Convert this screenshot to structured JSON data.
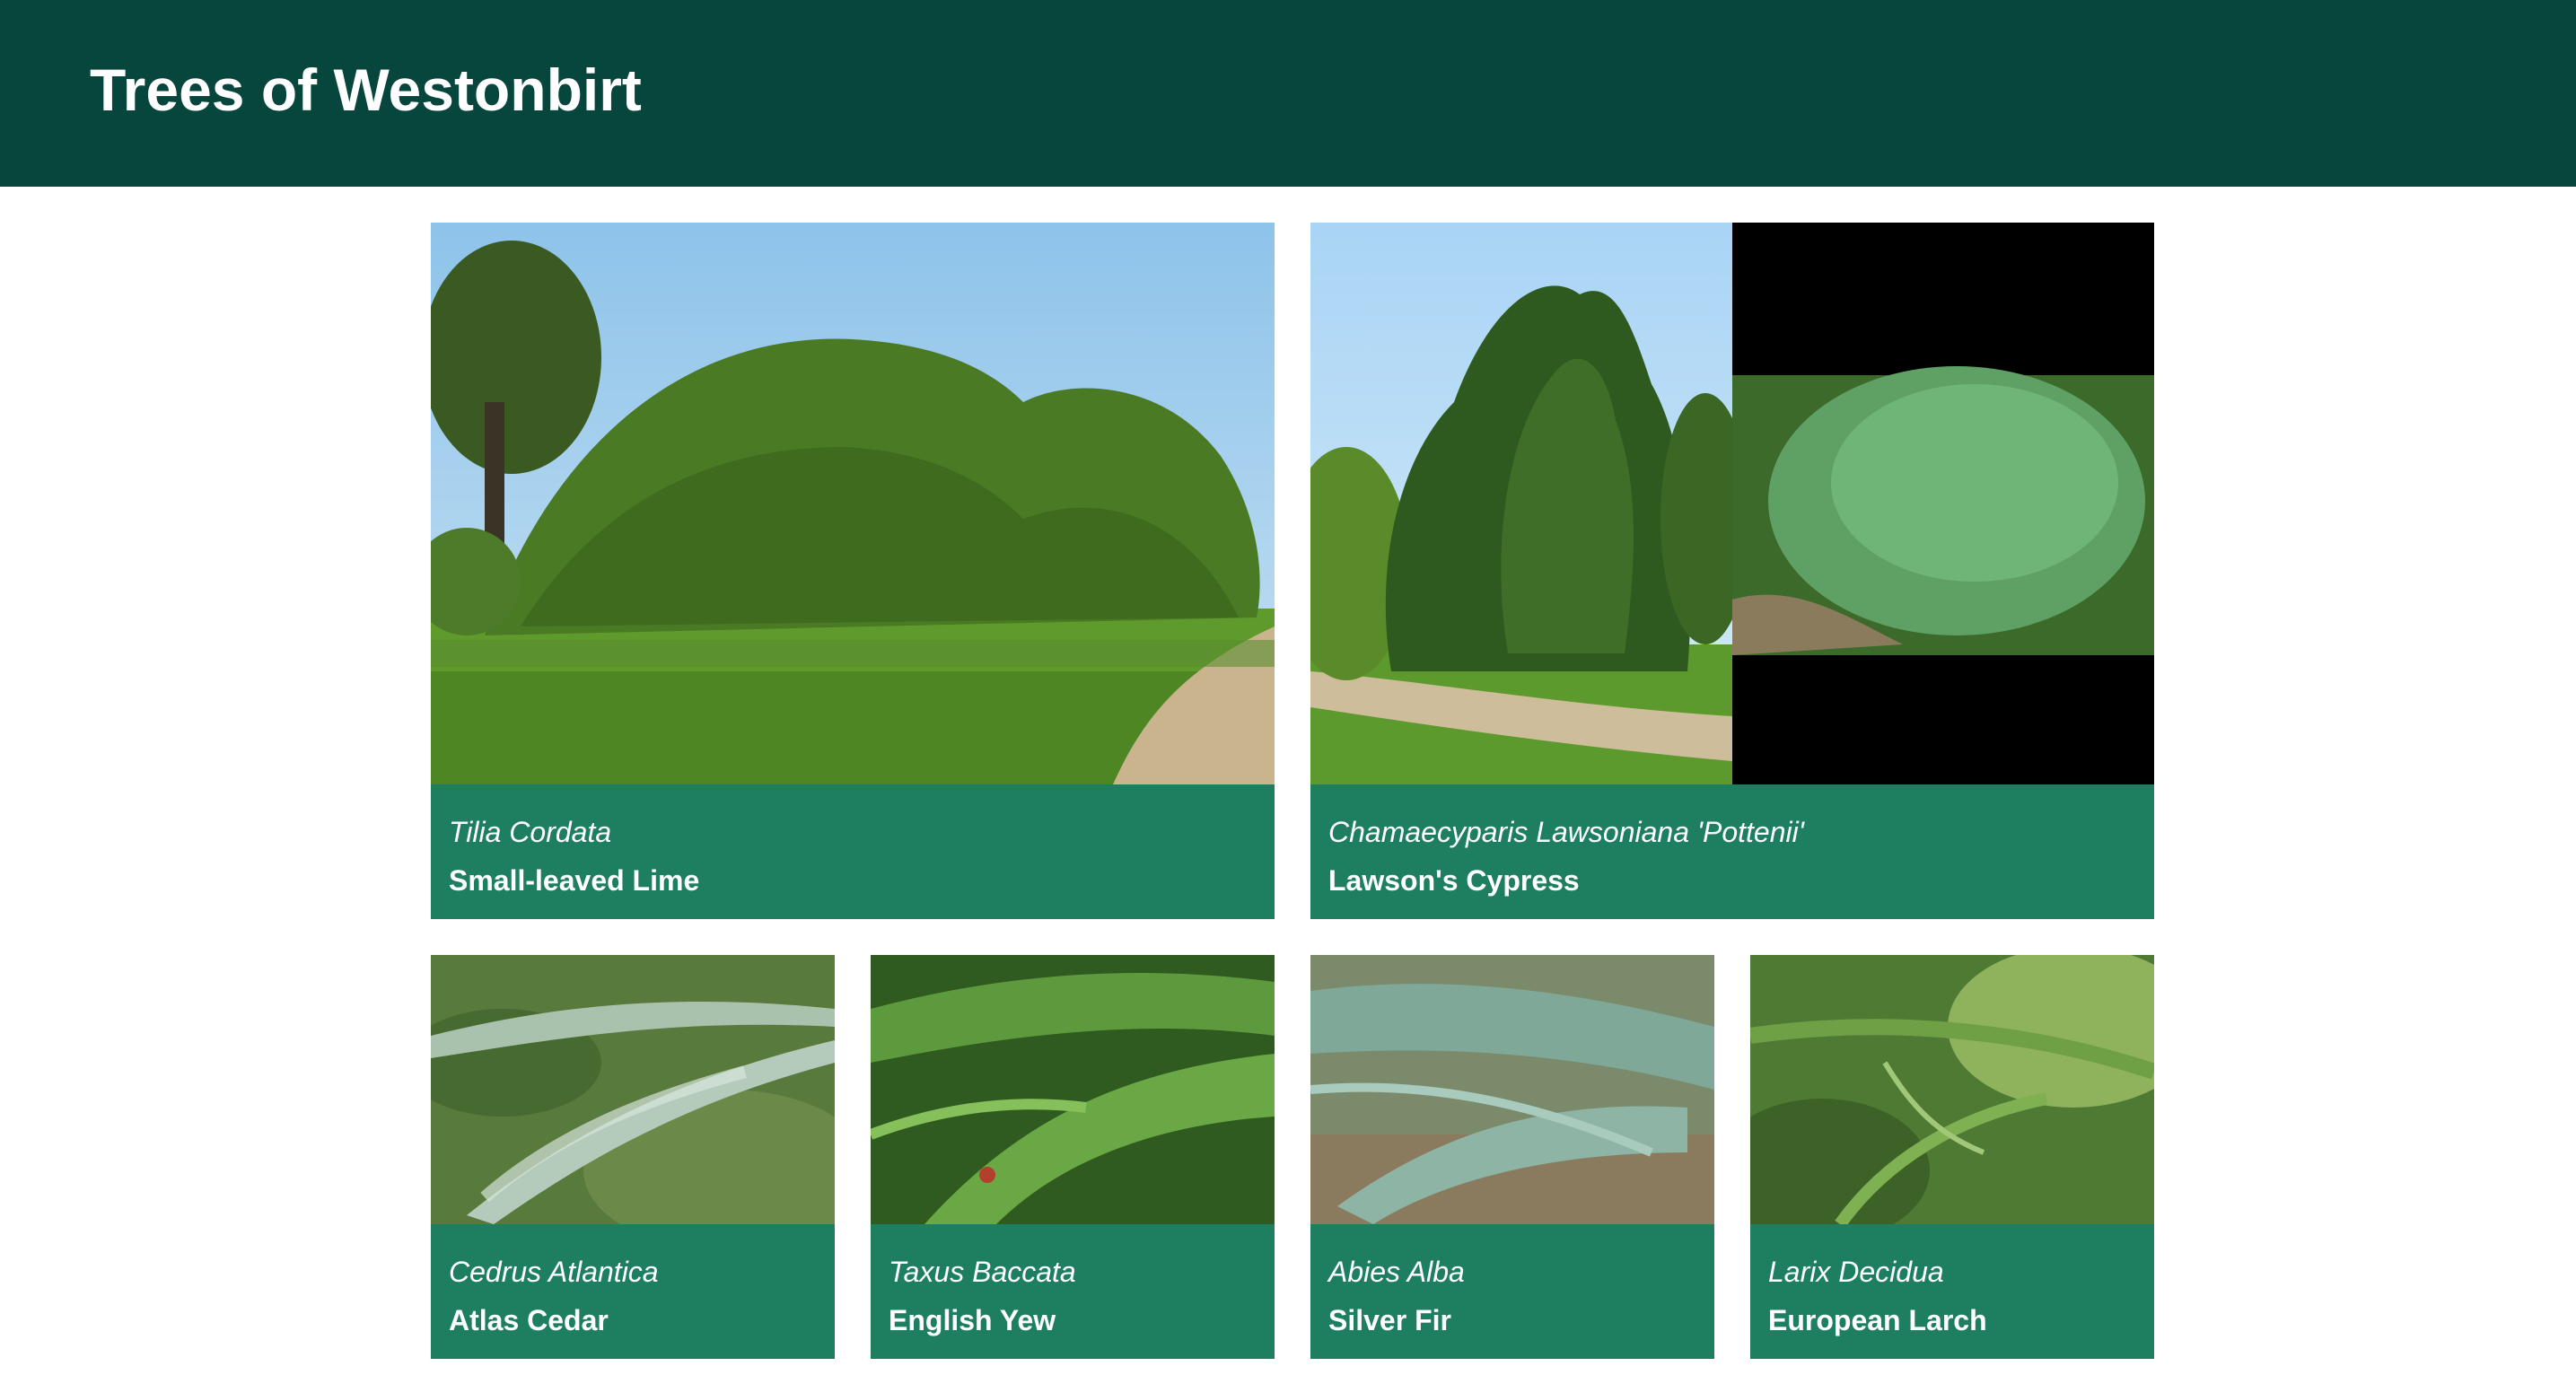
{
  "header": {
    "title": "Trees of Westonbirt"
  },
  "colors": {
    "header_bg": "#07463d",
    "caption_bg": "#1e7f60",
    "caption_text": "#ffffff"
  },
  "trees": [
    {
      "latin": "Tilia Cordata",
      "common": "Small-leaved Lime",
      "image": "lime-hedge-photo"
    },
    {
      "latin": "Chamaecyparis Lawsoniana 'Pottenii'",
      "common": "Lawson's Cypress",
      "image": "cypress-photo-pair"
    },
    {
      "latin": "Cedrus Atlantica",
      "common": "Atlas Cedar",
      "image": "cedar-branch-photo"
    },
    {
      "latin": "Taxus Baccata",
      "common": "English Yew",
      "image": "yew-branch-photo"
    },
    {
      "latin": "Abies Alba",
      "common": "Silver Fir",
      "image": "fir-branch-photo"
    },
    {
      "latin": "Larix Decidua",
      "common": "European Larch",
      "image": "larch-branch-photo"
    }
  ]
}
